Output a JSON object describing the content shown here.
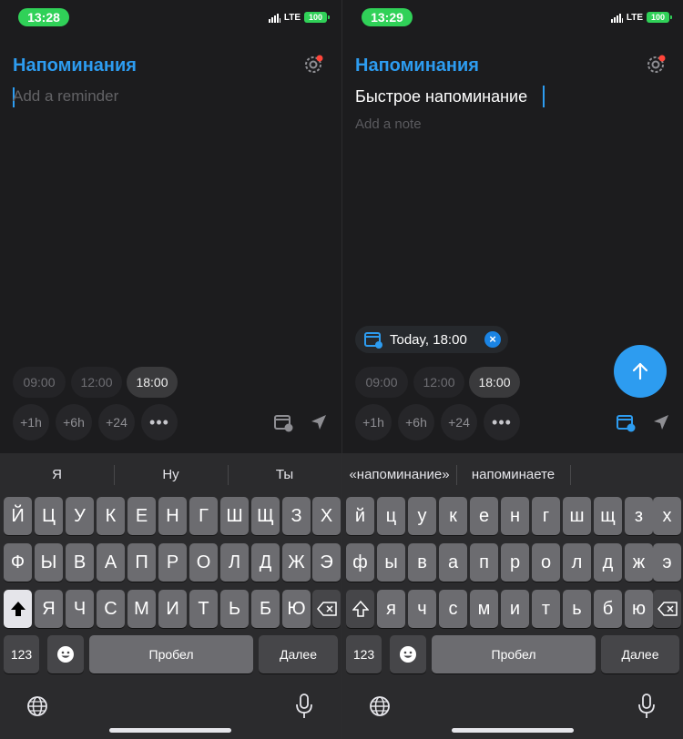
{
  "left": {
    "status": {
      "time": "13:28",
      "network": "LTE",
      "battery": "100"
    },
    "title": "Напоминания",
    "reminder_placeholder": "Add a reminder",
    "times": [
      "09:00",
      "12:00",
      "18:00"
    ],
    "offsets": [
      "+1h",
      "+6h",
      "+24"
    ],
    "more_label": "•••",
    "suggestions": [
      "Я",
      "Ну",
      "Ты"
    ],
    "keyboard": {
      "row1": [
        "Й",
        "Ц",
        "У",
        "К",
        "Е",
        "Н",
        "Г",
        "Ш",
        "Щ",
        "З",
        "Х"
      ],
      "row2": [
        "Ф",
        "Ы",
        "В",
        "А",
        "П",
        "Р",
        "О",
        "Л",
        "Д",
        "Ж",
        "Э"
      ],
      "row3": [
        "Я",
        "Ч",
        "С",
        "М",
        "И",
        "Т",
        "Ь",
        "Б",
        "Ю"
      ],
      "numbers": "123",
      "space": "Пробел",
      "return": "Далее"
    }
  },
  "right": {
    "status": {
      "time": "13:29",
      "network": "LTE",
      "battery": "100"
    },
    "title": "Напоминания",
    "reminder_text": "Быстрое напоминание",
    "note_placeholder": "Add a note",
    "date_chip": "Today, 18:00",
    "times": [
      "09:00",
      "12:00",
      "18:00"
    ],
    "offsets": [
      "+1h",
      "+6h",
      "+24"
    ],
    "more_label": "•••",
    "suggestions": [
      "«напоминание»",
      "напоминаете",
      ""
    ],
    "keyboard": {
      "row1": [
        "й",
        "ц",
        "у",
        "к",
        "е",
        "н",
        "г",
        "ш",
        "щ",
        "з",
        "х"
      ],
      "row2": [
        "ф",
        "ы",
        "в",
        "а",
        "п",
        "р",
        "о",
        "л",
        "д",
        "ж",
        "э"
      ],
      "row3": [
        "я",
        "ч",
        "с",
        "м",
        "и",
        "т",
        "ь",
        "б",
        "ю"
      ],
      "numbers": "123",
      "space": "Пробел",
      "return": "Далее"
    }
  },
  "colors": {
    "accent": "#2d9cf0",
    "status_green": "#30d158",
    "notification_dot": "#ff453a"
  },
  "icons": [
    "settings-gear-icon",
    "calendar-icon",
    "location-arrow-icon",
    "send-arrow-up-icon",
    "shift-icon",
    "delete-icon",
    "emoji-icon",
    "globe-icon",
    "microphone-icon",
    "clear-x-icon"
  ]
}
